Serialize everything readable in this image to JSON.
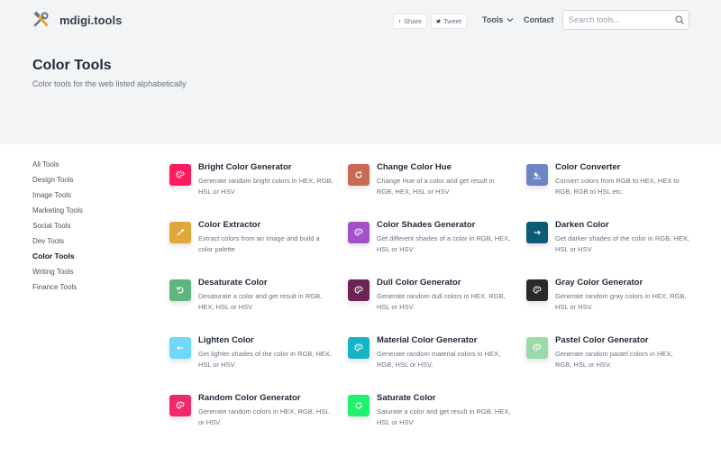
{
  "header": {
    "brand": "mdigi.tools",
    "share_label": "Share",
    "tweet_label": "Tweet",
    "nav_tools": "Tools",
    "nav_contact": "Contact",
    "search_placeholder": "Search tools...",
    "search_value": ""
  },
  "page": {
    "title": "Color Tools",
    "subtitle": "Color tools for the web listed alphabetically"
  },
  "sidebar": {
    "items": [
      {
        "label": "All Tools",
        "active": false
      },
      {
        "label": "Design Tools",
        "active": false
      },
      {
        "label": "Image Tools",
        "active": false
      },
      {
        "label": "Marketing Tools",
        "active": false
      },
      {
        "label": "Social Tools",
        "active": false
      },
      {
        "label": "Dev Tools",
        "active": false
      },
      {
        "label": "Color Tools",
        "active": true
      },
      {
        "label": "Writing Tools",
        "active": false
      },
      {
        "label": "Finance Tools",
        "active": false
      }
    ]
  },
  "tools": [
    {
      "title": "Bright Color Generator",
      "desc": "Generate random bright colors in HEX, RGB, HSL or HSV.",
      "color": "#ff1a5e",
      "icon": "palette-icon"
    },
    {
      "title": "Change Color Hue",
      "desc": "Change Hue of a color and get result in RGB, HEX, HSL or HSV",
      "color": "#c96a55",
      "icon": "rotate-cw-icon"
    },
    {
      "title": "Color Converter",
      "desc": "Convert colors from RGB to HEX, HEX to RGB, RGB to HSL etc.",
      "color": "#6b86c2",
      "icon": "paint-bucket-icon"
    },
    {
      "title": "Color Extractor",
      "desc": "Extract colors from an Image and build a color palette",
      "color": "#e0a83a",
      "icon": "eyedropper-icon"
    },
    {
      "title": "Color Shades Generator",
      "desc": "Get different shades of a color in RGB, HEX, HSL or HSV",
      "color": "#a251c7",
      "icon": "palette-icon"
    },
    {
      "title": "Darken Color",
      "desc": "Get darker shades of the color in RGB, HEX, HSL or HSV",
      "color": "#0b5a78",
      "icon": "arrow-right-icon"
    },
    {
      "title": "Desaturate Color",
      "desc": "Desaturate a color and get result in RGB, HEX, HSL or HSV",
      "color": "#5cb67e",
      "icon": "rotate-ccw-icon"
    },
    {
      "title": "Dull Color Generator",
      "desc": "Generate random dull colors in HEX, RGB, HSL or HSV.",
      "color": "#6b2456",
      "icon": "palette-icon"
    },
    {
      "title": "Gray Color Generator",
      "desc": "Generate random gray colors in HEX, RGB, HSL or HSV.",
      "color": "#2a2a2a",
      "icon": "palette-icon"
    },
    {
      "title": "Lighten Color",
      "desc": "Get lighter shades of the color in RGB, HEX, HSL or HSV",
      "color": "#6fd8fb",
      "icon": "arrow-left-icon"
    },
    {
      "title": "Material Color Generator",
      "desc": "Generate random material colors in HEX, RGB, HSL or HSV.",
      "color": "#15b3c6",
      "icon": "palette-icon"
    },
    {
      "title": "Pastel Color Generator",
      "desc": "Generate random pastel colors in HEX, RGB, HSL or HSV.",
      "color": "#9ad9a8",
      "icon": "palette-icon"
    },
    {
      "title": "Random Color Generator",
      "desc": "Generate random colors in HEX, RGB, HSL or HSV.",
      "color": "#f0296e",
      "icon": "palette-icon"
    },
    {
      "title": "Saturate Color",
      "desc": "Saturate a color and get result in RGB, HEX, HSL or HSV",
      "color": "#1ef26f",
      "icon": "rotate-cw-icon"
    }
  ]
}
